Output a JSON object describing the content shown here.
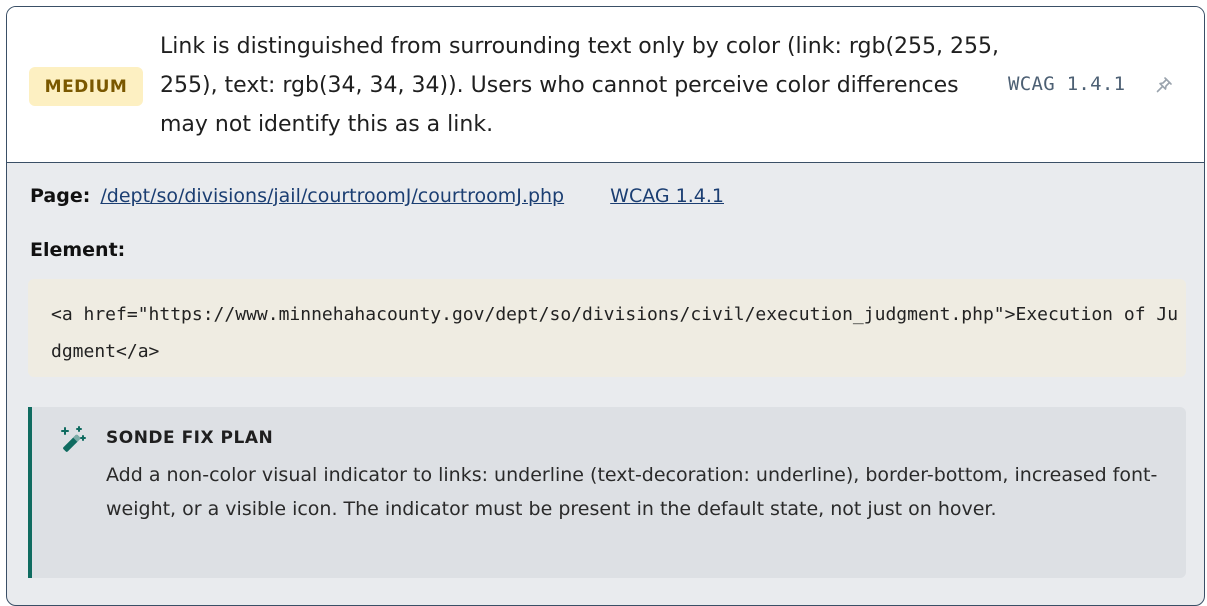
{
  "issue": {
    "severity": "MEDIUM",
    "description": "Link is distinguished from surrounding text only by color (link: rgb(255, 255, 255), text: rgb(34, 34, 34)). Users who cannot perceive color differences may not identify this as a link.",
    "wcag": "WCAG 1.4.1",
    "pin_icon": "pin-icon"
  },
  "details": {
    "page_label": "Page:",
    "page_path": "/dept/so/divisions/jail/courtroomJ/courtroomJ.php",
    "wcag_link": "WCAG 1.4.1",
    "element_label": "Element:",
    "element_code": "<a href=\"https://www.minnehahacounty.gov/dept/so/divisions/civil/execution_judgment.php\">Execution of Judgment</a>"
  },
  "fix_plan": {
    "icon": "magic-wand-icon",
    "title": "SONDE FIX PLAN",
    "text": "Add a non-color visual indicator to links: underline (text-decoration: underline), border-bottom, increased font-weight, or a visible icon. The indicator must be present in the default state, not just on hover."
  },
  "colors": {
    "badge_bg": "#fdf0c2",
    "badge_text": "#7a5800",
    "link": "#1b3e72",
    "fix_accent": "#0f6b60",
    "card_border": "#3a4f66"
  }
}
